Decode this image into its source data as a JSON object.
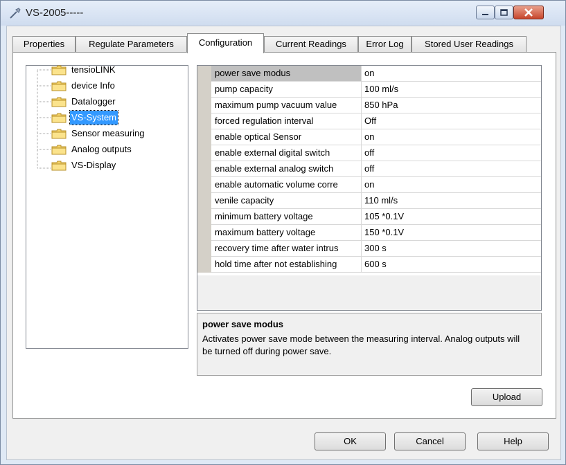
{
  "window": {
    "title": "VS-2005-----"
  },
  "tabs": [
    "Properties",
    "Regulate Parameters",
    "Configuration",
    "Current Readings",
    "Error Log",
    "Stored User Readings"
  ],
  "active_tab": "Configuration",
  "tree": {
    "items": [
      "tensioLINK",
      "device Info",
      "Datalogger",
      "VS-System",
      "Sensor measuring",
      "Analog outputs",
      "VS-Display"
    ],
    "selected": "VS-System"
  },
  "properties": [
    {
      "name": "power save modus",
      "value": "on"
    },
    {
      "name": "pump capacity",
      "value": "100 ml/s"
    },
    {
      "name": "maximum pump vacuum value",
      "value": "850 hPa"
    },
    {
      "name": "forced regulation interval",
      "value": "Off"
    },
    {
      "name": "enable optical Sensor",
      "value": "on"
    },
    {
      "name": "enable external digital switch",
      "value": "off"
    },
    {
      "name": "enable external analog switch",
      "value": "off"
    },
    {
      "name": "enable automatic volume corre",
      "value": "on"
    },
    {
      "name": "venile capacity",
      "value": "110 ml/s"
    },
    {
      "name": "minimum battery voltage",
      "value": "105 *0.1V"
    },
    {
      "name": "maximum battery voltage",
      "value": "150 *0.1V"
    },
    {
      "name": "recovery time after water intrus",
      "value": "300 s"
    },
    {
      "name": "hold time after not establishing",
      "value": "600 s"
    }
  ],
  "description": {
    "title": "power save modus",
    "text": "Activates power save mode between the measuring interval. Analog outputs will be turned off during power save."
  },
  "buttons": {
    "upload": "Upload",
    "ok": "OK",
    "cancel": "Cancel",
    "help": "Help"
  },
  "colors": {
    "selection": "#3399ff",
    "title_bar": "#cfdcef",
    "close_button": "#c7452c"
  },
  "icons": {
    "app": "tool-icon",
    "tree": "folder-icon"
  }
}
